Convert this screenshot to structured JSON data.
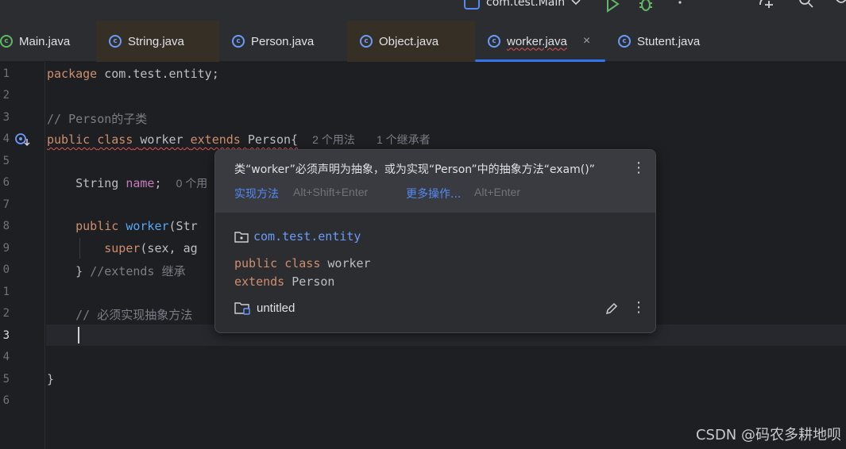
{
  "toolbar": {
    "run_config": "com.test.Main",
    "icons": [
      "run-icon",
      "debug-icon",
      "more-icon",
      "add-user-icon",
      "search-icon",
      "settings-icon"
    ]
  },
  "tabs": [
    {
      "label": "Main.java"
    },
    {
      "label": "String.java"
    },
    {
      "label": "Person.java"
    },
    {
      "label": "Object.java"
    },
    {
      "label": "worker.java",
      "close": "×"
    },
    {
      "label": "Stutent.java"
    }
  ],
  "gutter": {
    "line_numbers": [
      "1",
      "2",
      "3",
      "4",
      "5",
      "6",
      "7",
      "8",
      "9",
      "0",
      "1",
      "2",
      "3",
      "4",
      "5",
      "6"
    ]
  },
  "code": {
    "l1_kw": "package",
    "l1_rest": " com.test.entity;",
    "l3": "// Person的子类",
    "l4_public": "public",
    "l4_class": "class",
    "l4_name": "worker",
    "l4_extends": "extends",
    "l4_parent": "Person{",
    "l4_hint1": "2 个用法",
    "l4_hint2": "1 个继承者",
    "l6_type": "String",
    "l6_field": "name",
    "l6_semi": ";",
    "l6_hint": "0 个用",
    "l8_kw": "public",
    "l8_fn": "worker",
    "l8_rest": "(Str",
    "l9_kw": "super",
    "l9_rest": "(sex, ag",
    "l10_brace": "}",
    "l10_comment": "//extends 继承",
    "l12_comment": "// 必须实现抽象方法",
    "l15_brace": "}"
  },
  "popup": {
    "message": "类“worker”必须声明为抽象，或为实现“Person”中的抽象方法“exam()”",
    "action1": "实现方法",
    "action1_key": "Alt+Shift+Enter",
    "action2": "更多操作...",
    "action2_key": "Alt+Enter",
    "package": "com.test.entity",
    "decl_kw1": "public",
    "decl_kw2": "class",
    "decl_name": "worker",
    "decl_kw3": "extends",
    "decl_parent": "Person",
    "project": "untitled",
    "more": "⋮"
  },
  "watermark": "CSDN @码农多耕地呗"
}
